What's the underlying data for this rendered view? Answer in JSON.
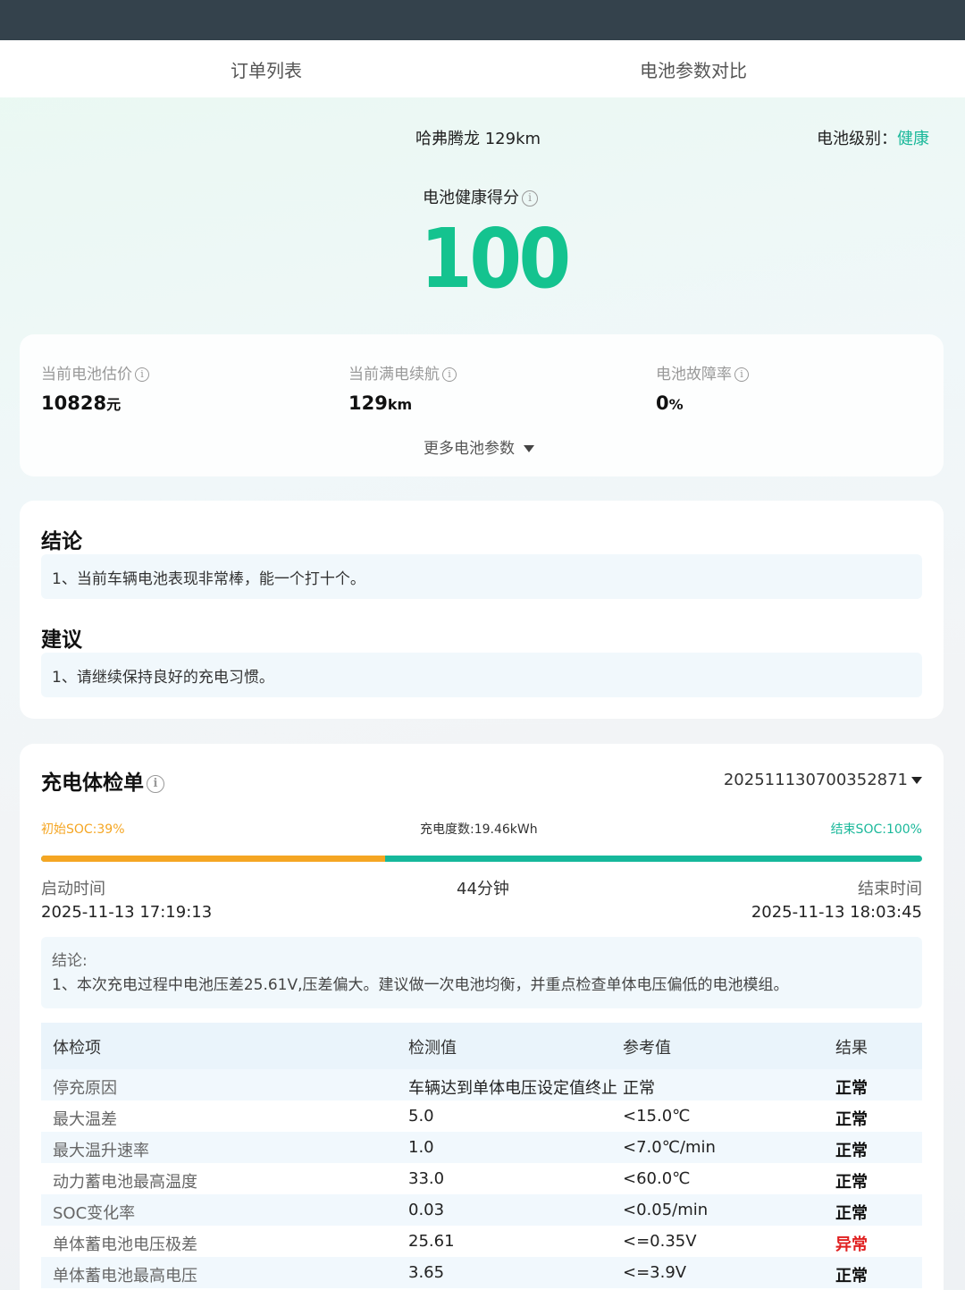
{
  "tabs": [
    "订单列表",
    "电池参数对比"
  ],
  "vehicle": {
    "name": "哈弗腾龙 129km",
    "level_label": "电池级别：",
    "level_value": "健康"
  },
  "health": {
    "title": "电池健康得分",
    "score": "100"
  },
  "stats": [
    {
      "label": "当前电池估价",
      "value": "10828",
      "unit": "元"
    },
    {
      "label": "当前满电续航",
      "value": "129",
      "unit": "km"
    },
    {
      "label": "电池故障率",
      "value": "0",
      "unit": "%"
    }
  ],
  "more_label": "更多电池参数",
  "conclusion": {
    "title": "结论",
    "text": "1、当前车辆电池表现非常棒，能一个打十个。"
  },
  "advice": {
    "title": "建议",
    "text": "1、请继续保持良好的充电习惯。"
  },
  "charge": {
    "title": "充电体检单",
    "order_no": "202511130700352871",
    "soc_start": "初始SOC:39%",
    "energy": "充电度数:19.46kWh",
    "soc_end": "结束SOC:100%",
    "soc_start_value": 0.39,
    "soc_end_value": 1.0,
    "start_label": "启动时间",
    "start_time": "2025-11-13 17:19:13",
    "duration": "44分钟",
    "end_label": "结束时间",
    "end_time": "2025-11-13 18:03:45",
    "conclusion_label": "结论:",
    "conclusion_text": "1、本次充电过程中电池压差25.61V,压差偏大。建议做一次电池均衡，并重点检查单体电压偏低的电池模组。",
    "table": {
      "headers": [
        "体检项",
        "检测值",
        "参考值",
        "结果"
      ],
      "rows": [
        [
          "停充原因",
          "车辆达到单体电压设定值终止",
          "正常",
          "正常"
        ],
        [
          "最大温差",
          "5.0",
          "<15.0℃",
          "正常"
        ],
        [
          "最大温升速率",
          "1.0",
          "<7.0℃/min",
          "正常"
        ],
        [
          "动力蓄电池最高温度",
          "33.0",
          "<60.0℃",
          "正常"
        ],
        [
          "SOC变化率",
          "0.03",
          "<0.05/min",
          "正常"
        ],
        [
          "单体蓄电池电压极差",
          "25.61",
          "<=0.35V",
          "异常"
        ],
        [
          "单体蓄电池最高电压",
          "3.65",
          "<=3.9V",
          "正常"
        ]
      ]
    }
  },
  "colors": {
    "accent": "#14c38f",
    "healthy": "#1ab89a",
    "soc_start": "#f5a623",
    "abnormal": "#e02020"
  }
}
